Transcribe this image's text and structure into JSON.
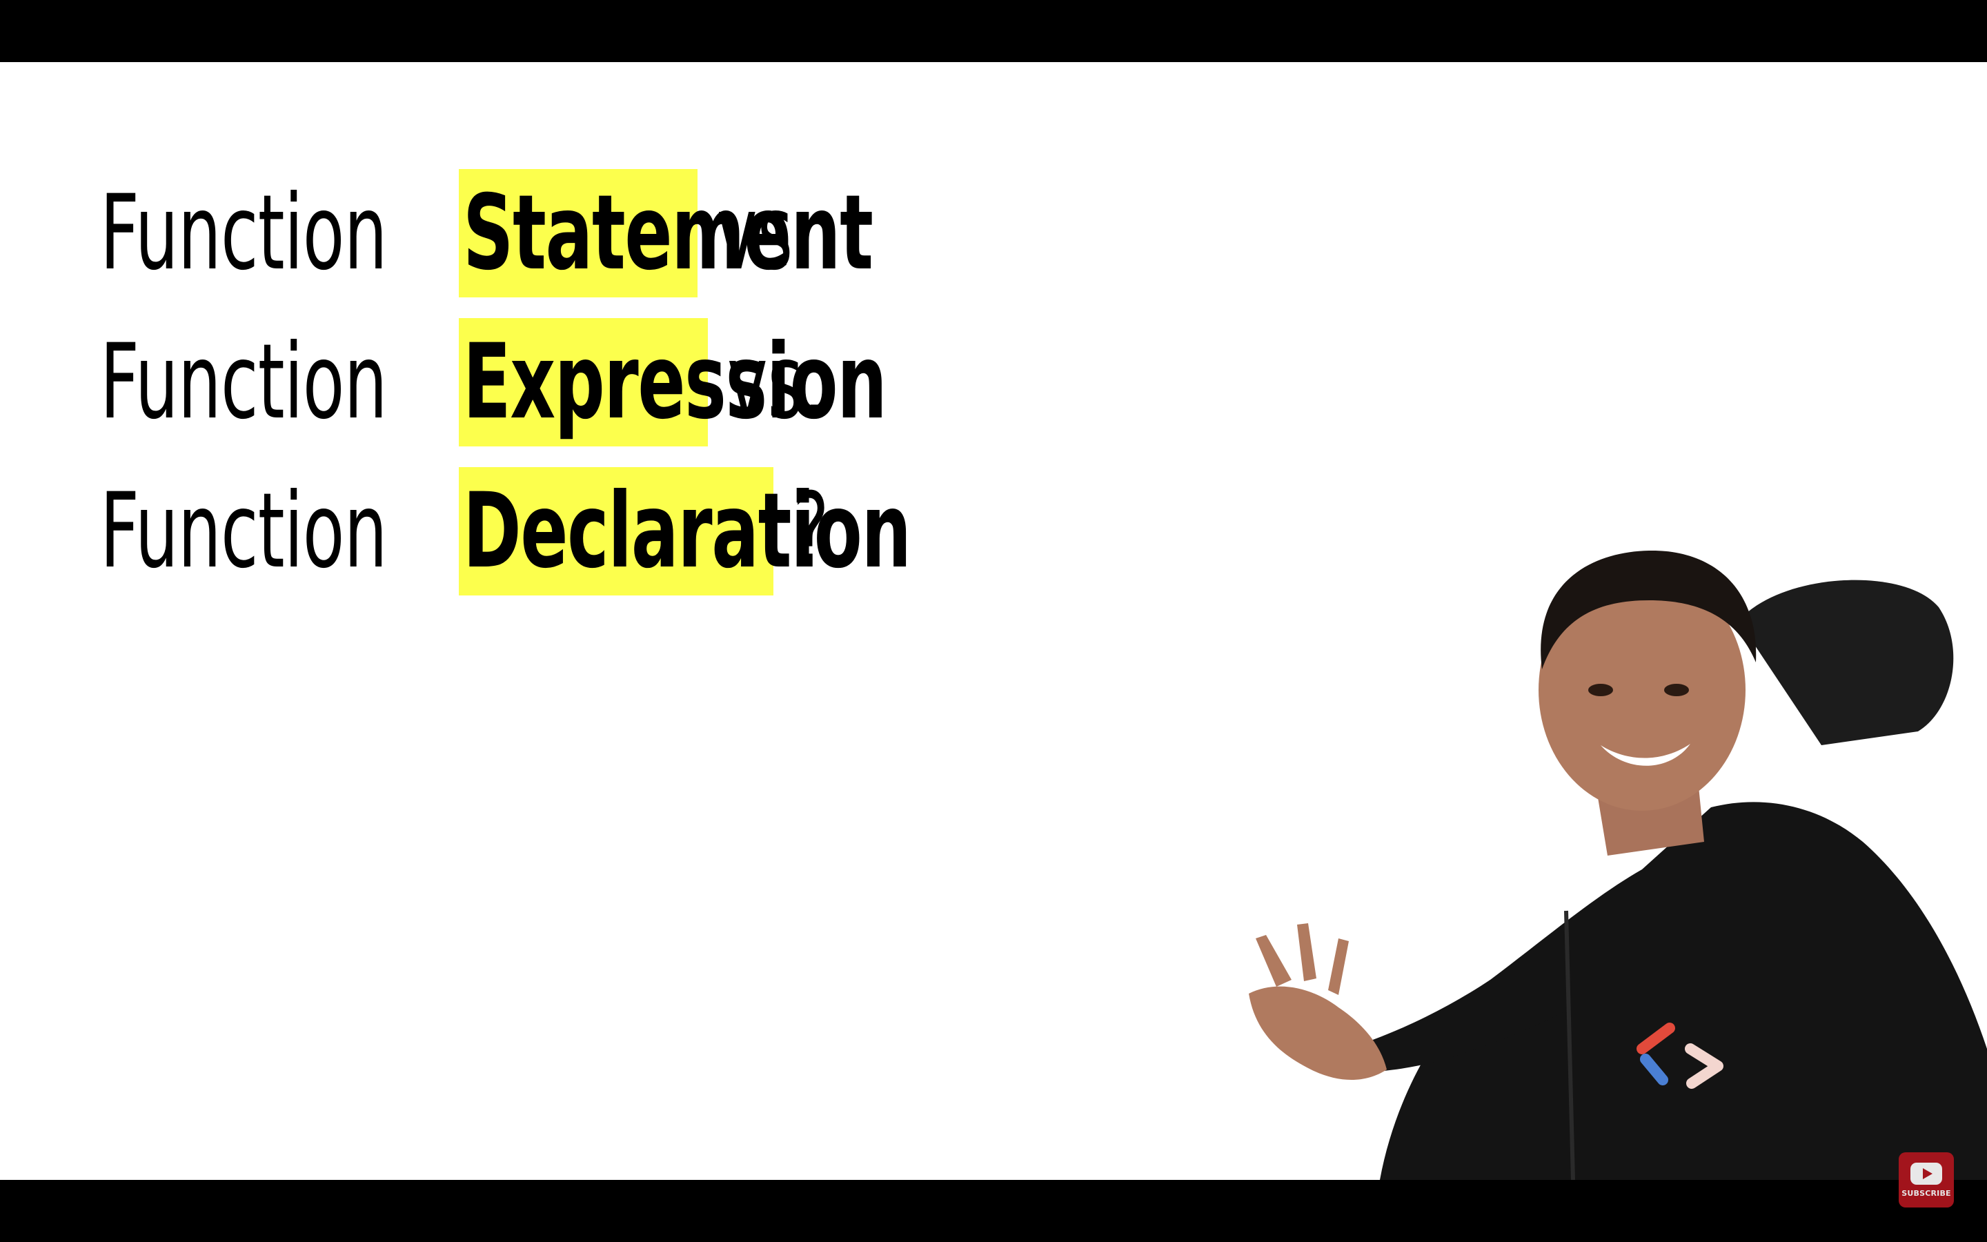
{
  "slide": {
    "lines": [
      {
        "lead": "Function",
        "highlight": "Statement",
        "tail": "vs."
      },
      {
        "lead": "Function",
        "highlight": "Expression",
        "tail": "vs."
      },
      {
        "lead": "Function",
        "highlight": "Declaration",
        "tail": "?"
      }
    ],
    "highlight_color": "#fcff4d",
    "text_color": "#000000",
    "background_color": "#ffffff"
  },
  "overlay": {
    "subscribe_label": "SUBSCRIBE",
    "subscribe_icon": "youtube-icon",
    "subscribe_color": "#b3161f"
  }
}
